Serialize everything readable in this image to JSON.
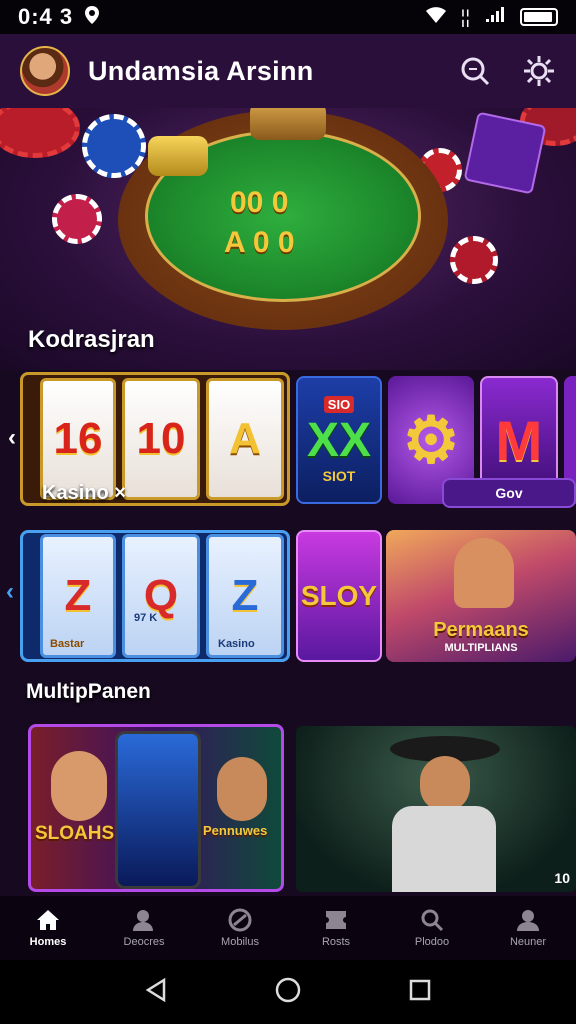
{
  "status_bar": {
    "time": "0:4 3",
    "signal": "¦¦",
    "icons": [
      "location-icon",
      "wifi-icon",
      "signal-icon",
      "battery-icon"
    ]
  },
  "app_bar": {
    "title": "Undamsia Arsinn",
    "icons": [
      "search-icon",
      "settings-icon"
    ]
  },
  "hero": {
    "felt_row1": "00 0",
    "felt_row2": "A 0 0"
  },
  "sections": {
    "first": "Kodrasjran",
    "second": "Kasino ×",
    "third": "MultipPanen"
  },
  "row1": {
    "reels": [
      "16",
      "10",
      "A"
    ],
    "tiles": [
      {
        "top": "SIO",
        "main": "XX",
        "sub": "SIOT"
      },
      {
        "main": "⚙"
      },
      {
        "main": "M"
      }
    ],
    "badge": "Gov"
  },
  "row2": {
    "reels": [
      "Z",
      "Q",
      "Z"
    ],
    "reel_labels": [
      "Bastar",
      "97 K",
      "Kasino"
    ],
    "slot_tile": "SLOY",
    "promo": {
      "title": "Permaans",
      "subtitle": "MULTIPLIANS"
    }
  },
  "row3": {
    "left": {
      "label_a": "SLOAHS",
      "label_b": "Pennuwes"
    },
    "right_badge": "10"
  },
  "bottom_nav": [
    {
      "label": "Homes",
      "icon": "home-icon",
      "active": true
    },
    {
      "label": "Deocres",
      "icon": "user-plus-icon",
      "active": false
    },
    {
      "label": "Mobilus",
      "icon": "globe-icon",
      "active": false
    },
    {
      "label": "Rosts",
      "icon": "ticket-icon",
      "active": false
    },
    {
      "label": "Plodoo",
      "icon": "search-icon",
      "active": false
    },
    {
      "label": "Neuner",
      "icon": "account-icon",
      "active": false
    }
  ],
  "colors": {
    "accent": "#a530e0",
    "bg": "#17091f",
    "gold": "#f3c83a"
  }
}
